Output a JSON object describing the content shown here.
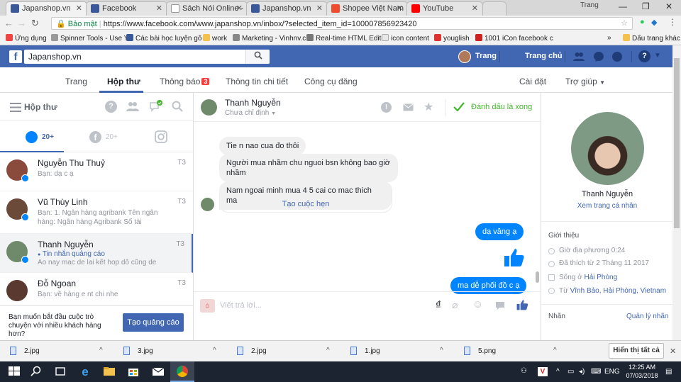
{
  "browser": {
    "tabs": [
      {
        "label": "Japanshop.vn",
        "active": true
      },
      {
        "label": "Facebook",
        "active": false
      },
      {
        "label": "Sách Nói Online -",
        "active": false
      },
      {
        "label": "Japanshop.vn",
        "active": false
      },
      {
        "label": "Shopee Việt Nam",
        "active": false
      },
      {
        "label": "YouTube",
        "active": false
      }
    ],
    "user_label": "Trang",
    "security_label": "Bảo mật",
    "url": "https://www.facebook.com/www.japanshop.vn/inbox/?selected_item_id=100007856923420",
    "bookmarks": [
      "Ứng dụng",
      "Spinner Tools - Use Y",
      "Các bài học luyện gõ",
      "work",
      "Marketing - Vinhnv.c",
      "Real-time HTML Edito",
      "icon content",
      "youglish",
      "1001 iCon facebook c"
    ],
    "bookmarks_more": "»",
    "other_bookmarks": "Dấu trang khác"
  },
  "fb": {
    "search_value": "Japanshop.vn",
    "user": "Trang",
    "home": "Trang chủ",
    "help_icon": "?"
  },
  "page_nav": {
    "items": [
      "Trang",
      "Hộp thư",
      "Thông báo",
      "Thông tin chi tiết",
      "Công cụ đăng"
    ],
    "notif_count": "3",
    "settings": "Cài đặt",
    "help": "Trợ giúp"
  },
  "inbox": {
    "title": "Hộp thư",
    "messenger_count": "20+",
    "facebook_count": "20+",
    "conversations": [
      {
        "name": "Nguyễn Thu Thuỷ",
        "preview": "Bạn: dạ c ạ",
        "time": "T3"
      },
      {
        "name": "Vũ Thùy Linh",
        "preview": "Bạn: 1. Ngân hàng agribank Tên ngân hàng: Ngân hàng Agribank Số tài khoản...",
        "time": "T3"
      },
      {
        "name": "Thanh Nguyễn",
        "tag": "Tin nhắn quảng cáo",
        "preview": "Ao nay mac de lai kết hop dô cũng de đ...",
        "time": "T3"
      },
      {
        "name": "Đỗ Ngoan",
        "preview": "Bạn: về hàng e nt chi nhe",
        "time": "T3"
      }
    ],
    "ad_prompt": "Bạn muốn bắt đầu cuộc trò chuyện với nhiều khách hàng hơn?",
    "ad_button": "Tạo quảng cáo"
  },
  "chat": {
    "contact_name": "Thanh Nguyễn",
    "assign_label": "Chưa chỉ định",
    "done_label": "Đánh dấu là xong",
    "messages_in": [
      "Tie n nao cua đo thôi",
      "Người  mua nhầm  chu nguoi bsn không bao giờ nhầm",
      "Nam ngoai minh mua 4  5 cai co mac thich  ma"
    ],
    "create_appointment": "Tạo cuộc hẹn",
    "messages_out": [
      "dạ vâng ạ",
      "ma dễ phối đồ c ạ"
    ],
    "composer_placeholder": "Viết trả lời...",
    "currency_symbol": "₫"
  },
  "profile": {
    "name": "Thanh Nguyễn",
    "view_profile": "Xem trang cá nhân",
    "intro_title": "Giới thiệu",
    "local_time": "Giờ địa phương 0:24",
    "liked_since": "Đã thích từ 2 Tháng 11 2017",
    "lives_prefix": "Sống ở ",
    "lives_in": "Hải Phòng",
    "from_prefix": "Từ ",
    "from": "Vĩnh Bảo, Hải Phòng, Vietnam",
    "labels_title": "Nhãn",
    "manage_labels": "Quản lý nhãn"
  },
  "downloads": {
    "files": [
      "2.jpg",
      "3.jpg",
      "2.jpg",
      "1.jpg",
      "5.png"
    ],
    "show_all": "Hiển thị tất cả"
  },
  "taskbar": {
    "language": "ENG",
    "time": "12:25 AM",
    "date": "07/03/2018"
  },
  "colors": {
    "fb_blue": "#4267b2",
    "messenger_blue": "#0084ff",
    "green_check": "#42b72a"
  }
}
